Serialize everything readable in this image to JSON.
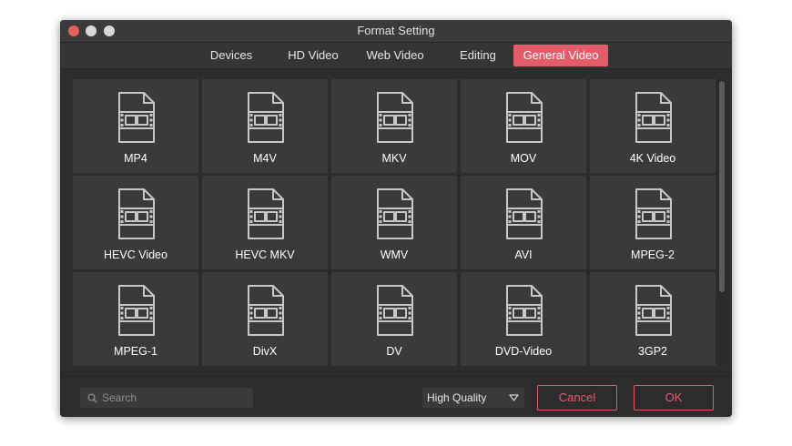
{
  "window": {
    "title": "Format Setting"
  },
  "tabs": [
    {
      "label": "Devices",
      "active": false
    },
    {
      "label": "HD Video",
      "active": false
    },
    {
      "label": "Web Video",
      "active": false
    },
    {
      "label": "Editing",
      "active": false
    },
    {
      "label": "General Video",
      "active": true
    }
  ],
  "formats": [
    {
      "label": "MP4",
      "icon": "video-file-icon"
    },
    {
      "label": "M4V",
      "icon": "video-file-icon"
    },
    {
      "label": "MKV",
      "icon": "video-file-icon"
    },
    {
      "label": "MOV",
      "icon": "video-file-icon"
    },
    {
      "label": "4K Video",
      "icon": "video-file-icon"
    },
    {
      "label": "HEVC Video",
      "icon": "video-file-icon"
    },
    {
      "label": "HEVC MKV",
      "icon": "video-file-icon"
    },
    {
      "label": "WMV",
      "icon": "video-file-icon"
    },
    {
      "label": "AVI",
      "icon": "video-file-icon"
    },
    {
      "label": "MPEG-2",
      "icon": "video-file-icon"
    },
    {
      "label": "MPEG-1",
      "icon": "video-file-icon"
    },
    {
      "label": "DivX",
      "icon": "video-file-icon"
    },
    {
      "label": "DV",
      "icon": "video-file-icon"
    },
    {
      "label": "DVD-Video",
      "icon": "video-file-icon"
    },
    {
      "label": "3GP2",
      "icon": "video-file-icon"
    }
  ],
  "search": {
    "placeholder": "Search",
    "value": ""
  },
  "quality": {
    "selected": "High Quality"
  },
  "buttons": {
    "cancel": "Cancel",
    "ok": "OK"
  },
  "colors": {
    "accent": "#e35c69",
    "background": "#2c2c2c",
    "tile": "#3a3a3a",
    "traffic_close": "#e5605b"
  }
}
